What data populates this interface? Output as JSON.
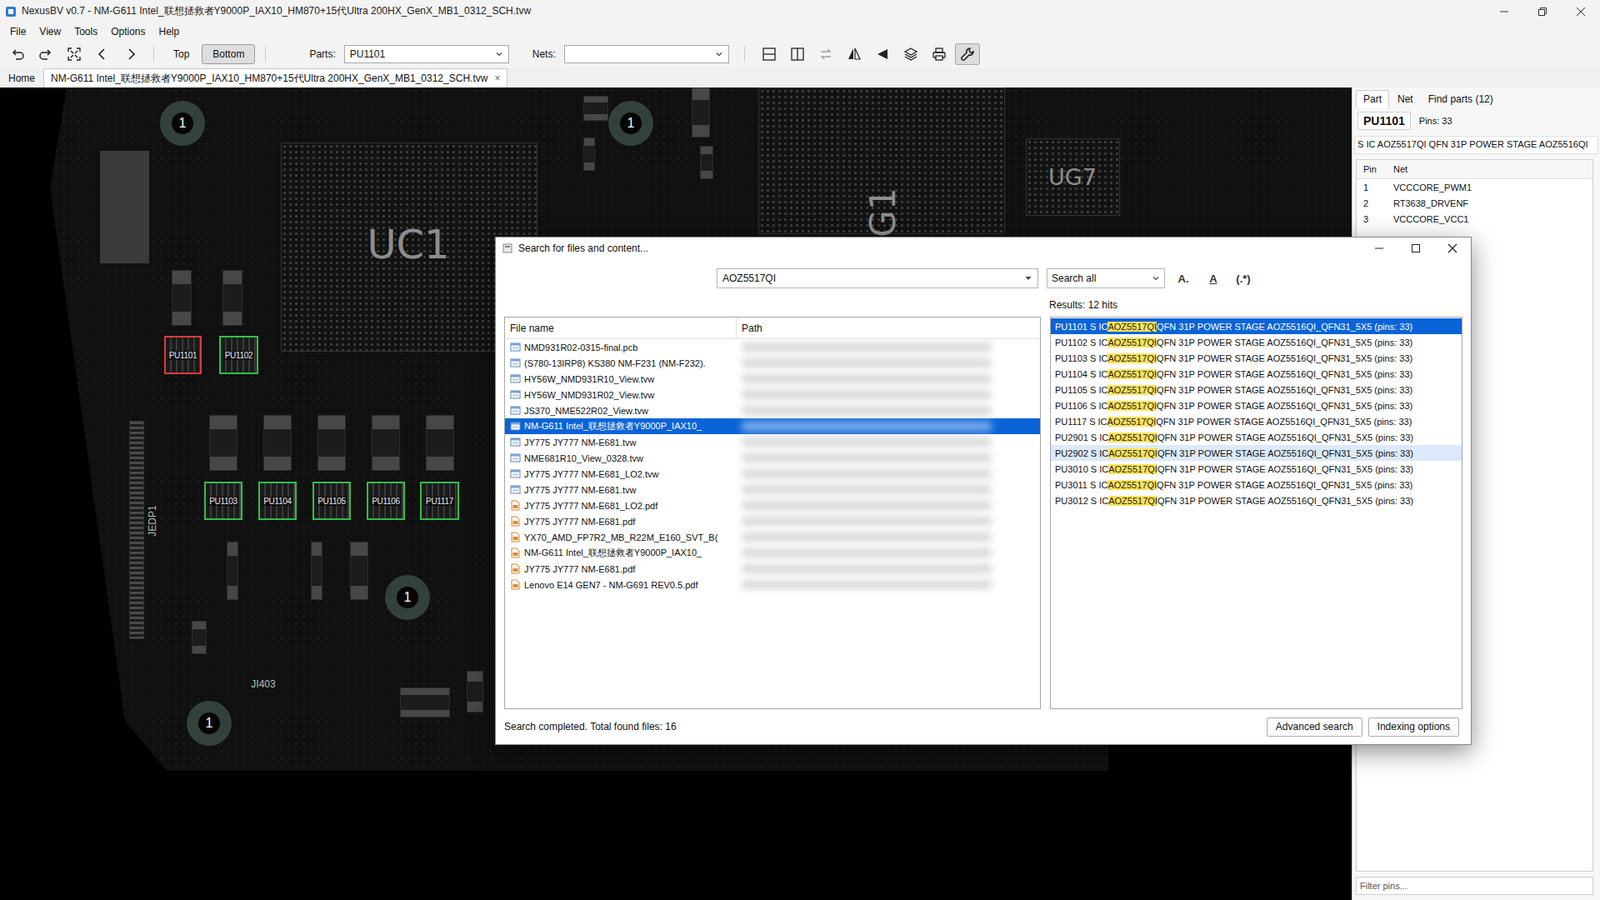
{
  "window": {
    "title": "NexusBV v0.7 - NM-G611 Intel_联想拯救者Y9000P_IAX10_HM870+15代Ultra 200HX_GenX_MB1_0312_SCH.tvw"
  },
  "menu": [
    "File",
    "View",
    "Tools",
    "Options",
    "Help"
  ],
  "toolbar": {
    "layers": [
      {
        "label": "Top",
        "selected": false
      },
      {
        "label": "Bottom",
        "selected": true
      }
    ],
    "parts_label": "Parts:",
    "parts_value": "PU1101",
    "nets_label": "Nets:",
    "nets_value": "",
    "tools": [
      {
        "kind": "split-h",
        "selected": false,
        "disabled": false
      },
      {
        "kind": "split-v",
        "selected": false,
        "disabled": false
      },
      {
        "kind": "swap",
        "selected": false,
        "disabled": true
      },
      {
        "kind": "mirror",
        "selected": false,
        "disabled": false
      },
      {
        "kind": "flip",
        "selected": false,
        "disabled": false
      },
      {
        "kind": "layers",
        "selected": false,
        "disabled": false
      },
      {
        "kind": "print",
        "selected": false,
        "disabled": false
      },
      {
        "kind": "wrench",
        "selected": true,
        "disabled": false
      }
    ]
  },
  "tabs": [
    {
      "label": "Home",
      "selected": false,
      "closable": false,
      "close": ""
    },
    {
      "label": "NM-G611 Intel_联想拯救者Y9000P_IAX10_HM870+15代Ultra 200HX_GenX_MB1_0312_SCH.tvw",
      "selected": true,
      "closable": true,
      "close": "×"
    }
  ],
  "board": {
    "chips": [
      {
        "label": "UC1"
      },
      {
        "label": "G1"
      },
      {
        "label": "UG7"
      }
    ],
    "parts": [
      {
        "label": "PU1101",
        "selected": true,
        "color": "#e03a3a"
      },
      {
        "label": "PU1102",
        "selected": false,
        "color": "#2fbf4a"
      },
      {
        "label": "PU1103",
        "selected": false,
        "color": "#2fbf4a"
      },
      {
        "label": "PU1104",
        "selected": false,
        "color": "#2fbf4a"
      },
      {
        "label": "PU1105",
        "selected": false,
        "color": "#2fbf4a"
      },
      {
        "label": "PU1106",
        "selected": false,
        "color": "#2fbf4a"
      },
      {
        "label": "PU1117",
        "selected": false,
        "color": "#2fbf4a"
      }
    ],
    "holes": [
      "1",
      "1",
      "1",
      "1"
    ],
    "silk": [
      "JEDP1",
      "JI403"
    ]
  },
  "panel": {
    "tabs": [
      {
        "label": "Part",
        "selected": true
      },
      {
        "label": "Net",
        "selected": false
      },
      {
        "label": "Find parts (12)",
        "selected": false
      }
    ],
    "part": "PU1101",
    "pins": "Pins: 33",
    "description": "S IC AOZ5517QI QFN 31P POWER STAGE AOZ5516QI",
    "columns": [
      "Pin",
      "Net"
    ],
    "rows": [
      {
        "pin": "1",
        "net": "VCCCORE_PWM1"
      },
      {
        "pin": "2",
        "net": "RT3638_DRVENF"
      },
      {
        "pin": "3",
        "net": "VCCCORE_VCC1"
      }
    ],
    "filter_placeholder": "Filter pins..."
  },
  "dialog": {
    "title": "Search for files and content...",
    "query": "AOZ5517QI",
    "scope": "Search all",
    "options": [
      {
        "label": "A.",
        "kind": "plain"
      },
      {
        "label": "A",
        "kind": "underline"
      },
      {
        "label": "(.*)",
        "kind": "plain"
      }
    ],
    "results_label": "Results: 12 hits",
    "file_columns": [
      "File name",
      "Path"
    ],
    "files": [
      {
        "name": "NMD931R02-0315-final.pcb",
        "kind": "board",
        "selected": false
      },
      {
        "name": "(S780-13IRP8) KS380 NM-F231 (NM-F232).",
        "kind": "board",
        "selected": false
      },
      {
        "name": "HY56W_NMD931R10_View.tvw",
        "kind": "board",
        "selected": false
      },
      {
        "name": "HY56W_NMD931R02_View.tvw",
        "kind": "board",
        "selected": false
      },
      {
        "name": "JS370_NME522R02_View.tvw",
        "kind": "board",
        "selected": false
      },
      {
        "name": "NM-G611 Intel_联想拯救者Y9000P_IAX10_",
        "kind": "board",
        "selected": true
      },
      {
        "name": "JY775 JY777 NM-E681.tvw",
        "kind": "board",
        "selected": false
      },
      {
        "name": "NME681R10_View_0328.tvw",
        "kind": "board",
        "selected": false
      },
      {
        "name": "JY775 JY777 NM-E681_LO2.tvw",
        "kind": "board",
        "selected": false
      },
      {
        "name": "JY775 JY777 NM-E681.tvw",
        "kind": "board",
        "selected": false
      },
      {
        "name": "JY775 JY777 NM-E681_LO2.pdf",
        "kind": "pdf",
        "selected": false
      },
      {
        "name": "JY775 JY777 NM-E681.pdf",
        "kind": "pdf",
        "selected": false
      },
      {
        "name": "YX70_AMD_FP7R2_MB_R22M_E160_SVT_B(",
        "kind": "pdf",
        "selected": false
      },
      {
        "name": "NM-G611 Intel_联想拯救者Y9000P_IAX10_",
        "kind": "pdf",
        "selected": false
      },
      {
        "name": "JY775 JY777 NM-E681.pdf",
        "kind": "pdf",
        "selected": false
      },
      {
        "name": "Lenovo E14 GEN7 - NM-G691 REV0.5.pdf",
        "kind": "pdf",
        "selected": false
      }
    ],
    "results": [
      {
        "before": "PU1101 S IC ",
        "match": "AOZ5517QI",
        "after": " QFN 31P POWER STAGE AOZ5516QI_QFN31_5X5 (pins: 33)",
        "selected": true,
        "hovered": false
      },
      {
        "before": "PU1102 S IC ",
        "match": "AOZ5517QI",
        "after": " QFN 31P POWER STAGE AOZ5516QI_QFN31_5X5 (pins: 33)",
        "selected": false,
        "hovered": false
      },
      {
        "before": "PU1103 S IC ",
        "match": "AOZ5517QI",
        "after": " QFN 31P POWER STAGE AOZ5516QI_QFN31_5X5 (pins: 33)",
        "selected": false,
        "hovered": false
      },
      {
        "before": "PU1104 S IC ",
        "match": "AOZ5517QI",
        "after": " QFN 31P POWER STAGE AOZ5516QI_QFN31_5X5 (pins: 33)",
        "selected": false,
        "hovered": false
      },
      {
        "before": "PU1105 S IC ",
        "match": "AOZ5517QI",
        "after": " QFN 31P POWER STAGE AOZ5516QI_QFN31_5X5 (pins: 33)",
        "selected": false,
        "hovered": false
      },
      {
        "before": "PU1106 S IC ",
        "match": "AOZ5517QI",
        "after": " QFN 31P POWER STAGE AOZ5516QI_QFN31_5X5 (pins: 33)",
        "selected": false,
        "hovered": false
      },
      {
        "before": "PU1117 S IC ",
        "match": "AOZ5517QI",
        "after": " QFN 31P POWER STAGE AOZ5516QI_QFN31_5X5 (pins: 33)",
        "selected": false,
        "hovered": false
      },
      {
        "before": "PU2901 S IC ",
        "match": "AOZ5517QI",
        "after": " QFN 31P POWER STAGE AOZ5516QI_QFN31_5X5 (pins: 33)",
        "selected": false,
        "hovered": false
      },
      {
        "before": "PU2902 S IC ",
        "match": "AOZ5517QI",
        "after": " QFN 31P POWER STAGE AOZ5516QI_QFN31_5X5 (pins: 33)",
        "selected": false,
        "hovered": true
      },
      {
        "before": "PU3010 S IC ",
        "match": "AOZ5517QI",
        "after": " QFN 31P POWER STAGE AOZ5516QI_QFN31_5X5 (pins: 33)",
        "selected": false,
        "hovered": false
      },
      {
        "before": "PU3011 S IC ",
        "match": "AOZ5517QI",
        "after": " QFN 31P POWER STAGE AOZ5516QI_QFN31_5X5 (pins: 33)",
        "selected": false,
        "hovered": false
      },
      {
        "before": "PU3012 S IC ",
        "match": "AOZ5517QI",
        "after": " QFN 31P POWER STAGE AOZ5516QI_QFN31_5X5 (pins: 33)",
        "selected": false,
        "hovered": false
      }
    ],
    "status": "Search completed. Total found files: 16",
    "buttons": [
      "Advanced search",
      "Indexing options"
    ]
  }
}
